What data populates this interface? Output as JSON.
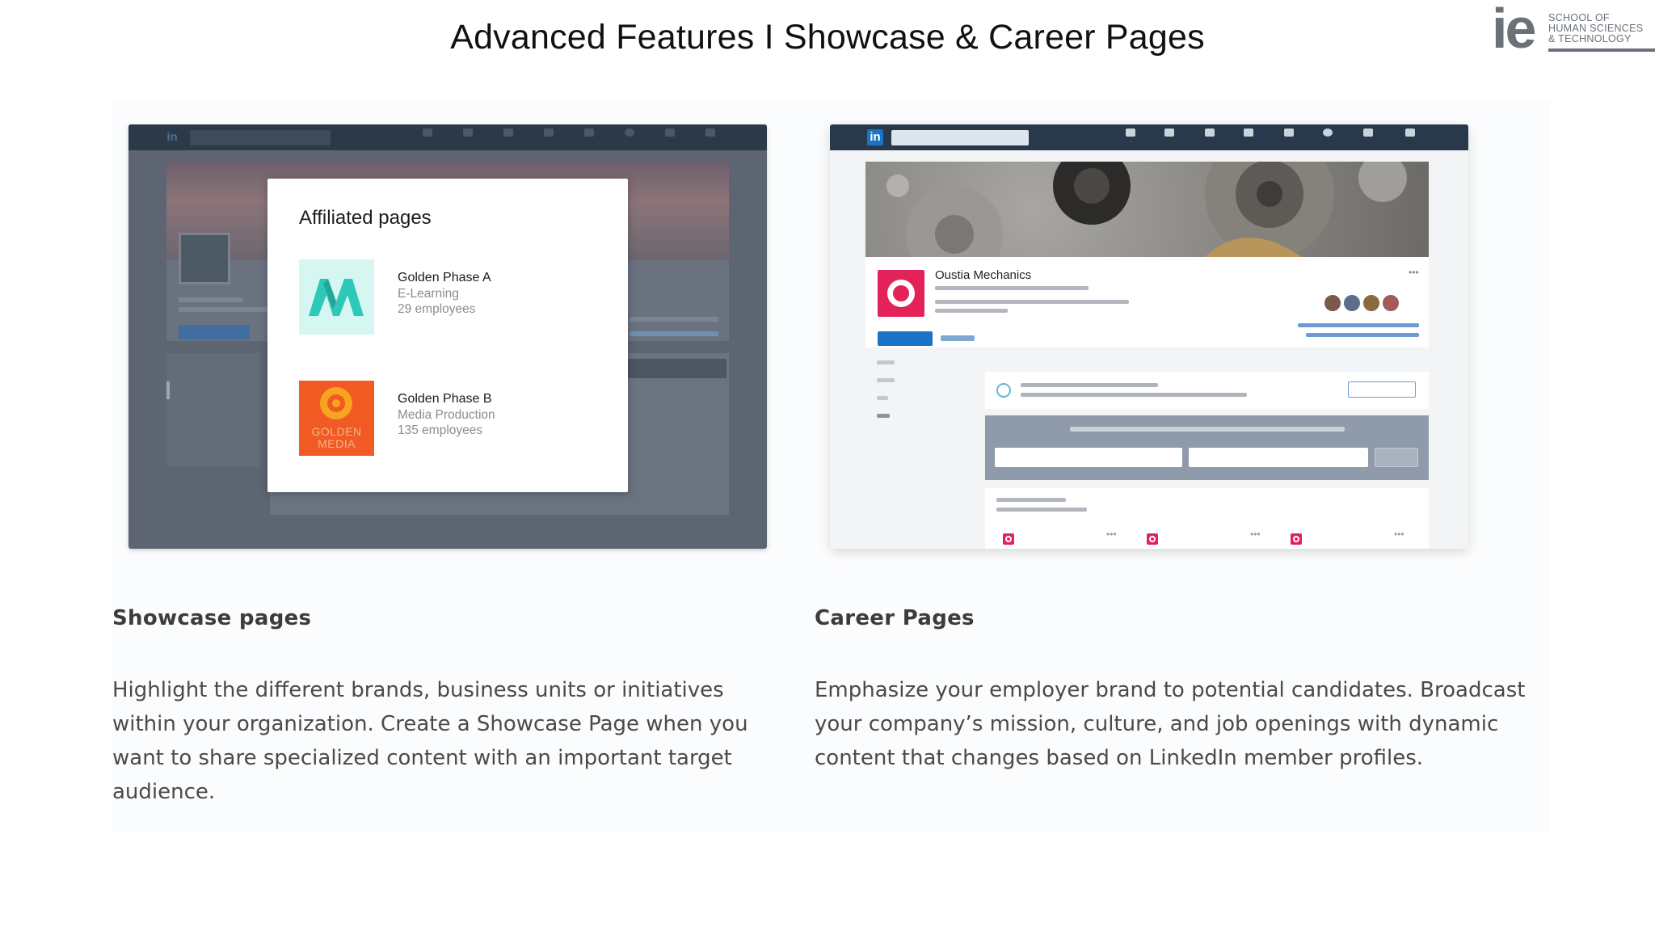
{
  "slide": {
    "title": "Advanced Features I Showcase & Career Pages",
    "logo": {
      "mark": "ie",
      "lines": [
        "SCHOOL OF",
        "HUMAN SCIENCES",
        "& TECHNOLOGY"
      ],
      "color": "#6a7179"
    }
  },
  "showcase": {
    "heading": "Showcase pages",
    "body": "Highlight the different brands, business units or initiatives within your organization. Create a Showcase Page when you want to share specialized content with an important target audience.",
    "screenshot": {
      "nav_logo": "in",
      "modal": {
        "title": "Affiliated pages",
        "items": [
          {
            "name": "Golden Phase A",
            "category": "E-Learning",
            "employees": "29 employees",
            "logo_icon": "m-letter-logo-icon"
          },
          {
            "name": "Golden Phase B",
            "category": "Media Production",
            "employees": "135 employees",
            "logo_icon": "golden-media-logo-icon",
            "logo_text": [
              "GOLDEN",
              "MEDIA"
            ]
          }
        ]
      }
    }
  },
  "career": {
    "heading": "Career Pages",
    "body": "Emphasize your employer brand to potential candidates. Broadcast your company’s mission, culture, and job openings with dynamic content that changes based on LinkedIn member profiles.",
    "screenshot": {
      "nav_logo": "in",
      "company_name": "Oustia Mechanics",
      "brand_color": "#e3225a",
      "accent": "#1a73c4"
    }
  }
}
